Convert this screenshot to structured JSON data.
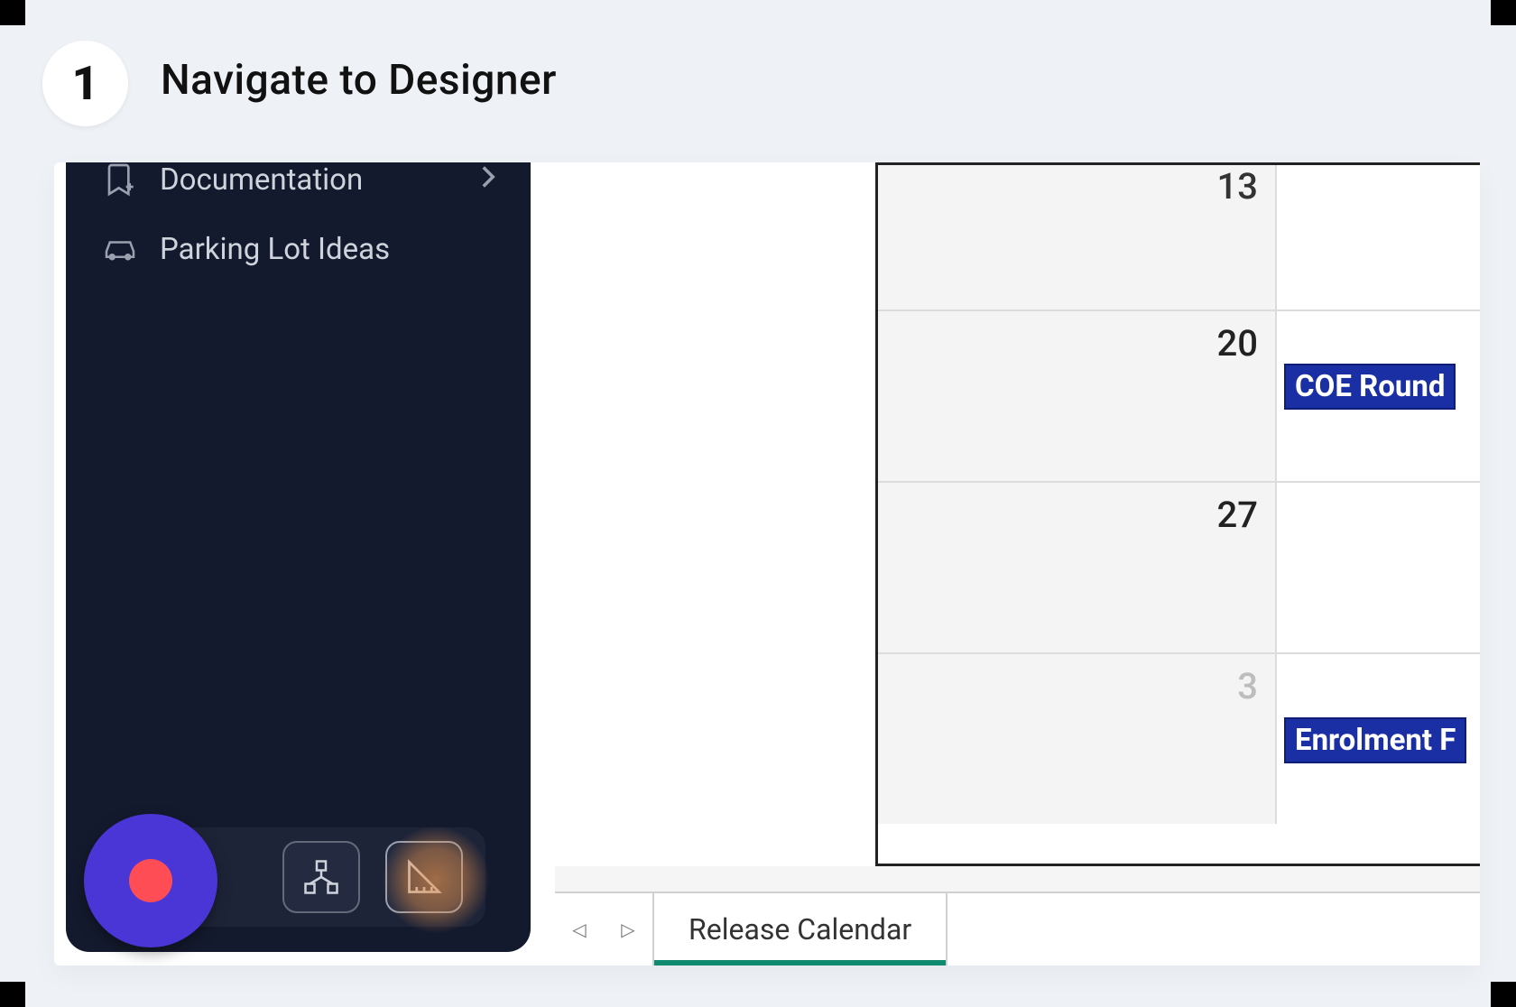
{
  "step": {
    "number": "1",
    "title": "Navigate to Designer"
  },
  "sidebar": {
    "items": [
      {
        "label": "Documentation",
        "has_chevron": true
      },
      {
        "label": "Parking Lot Ideas",
        "has_chevron": false
      }
    ]
  },
  "calendar": {
    "rows": [
      {
        "day": "13",
        "event": null,
        "partial": true
      },
      {
        "day": "20",
        "event": "COE Round"
      },
      {
        "day": "27",
        "event": null
      },
      {
        "day": "3",
        "event": "Enrolment F",
        "muted": true
      }
    ]
  },
  "tabs": {
    "nav_prev": "◁",
    "nav_next": "▷",
    "active": "Release Calendar"
  }
}
